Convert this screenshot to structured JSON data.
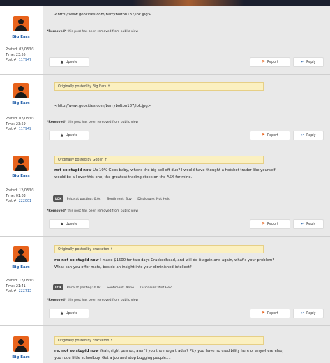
{
  "removed": {
    "label": "*Removed*",
    "rest": " this post has been removed from public view"
  },
  "buttons": {
    "upvote": "Upvote",
    "report": "Report",
    "reply": "Reply"
  },
  "meta_labels": {
    "posted": "Posted:",
    "time": "Time:",
    "post": "Post #:"
  },
  "colors": {
    "accent": "#e8631c",
    "link": "#1f5da8",
    "quote_bg": "#fbf0c0"
  },
  "icons": {
    "avatar": "user-silhouette-icon",
    "upvote": "thumbs-up-icon",
    "report": "flag-icon",
    "reply": "reply-icon"
  },
  "posts": [
    {
      "username": "Big Ears",
      "posted": "02/03/03",
      "time": "23:55",
      "post_no": "117947",
      "body": "<http://www.geocities.com/barrybolton187/lok.jpg>"
    },
    {
      "username": "Big Ears",
      "posted": "02/03/03",
      "time": "23:59",
      "post_no": "117949",
      "quote": "Originally posted by Big Ears ↑",
      "body": "<http://www.geocities.com/barrybolton187/lok.jpg>"
    },
    {
      "username": "Big Ears",
      "posted": "12/03/03",
      "time": "01:03",
      "post_no": "222001",
      "quote": "Originally posted by Goblin ↑",
      "body_bold": "not so stupid now",
      "body_lines": [
        " Up 10% Gobs baby, whens the big sell off due? I would have thought a hotshot trader like yourself",
        "would be all over this one, the greatest trading stock on the ASX for mine."
      ],
      "stock": "LOK",
      "price": "Price at posting: 0.0¢",
      "sentiment": "Sentiment: Buy",
      "disclosure": "Disclosure: Not Held"
    },
    {
      "username": "Big Ears",
      "posted": "12/03/03",
      "time": "21:41",
      "post_no": "222713",
      "quote": "Originally posted by cracketon ↑",
      "body_bold": "re: not so stupid now",
      "body_lines": [
        " I made $1500 for two days Crackedhead, and will do it again and again, what's your problem?",
        "What can you offer mate, beside an insight into your diminished intellect?"
      ],
      "stock": "LOK",
      "price": "Price at posting: 0.0¢",
      "sentiment": "Sentiment: None",
      "disclosure": "Disclosure: Not Held"
    },
    {
      "username": "Big Ears",
      "quote": "Originally posted by cracketon ↑",
      "body_bold": "re: not so stupid now",
      "body_lines": [
        " Yeah, right peanut, aren't you the mega trader? Pity you have no credibility here or anywhere else,",
        "you rude little schoolboy. Get a job and stop bugging people...."
      ]
    }
  ]
}
